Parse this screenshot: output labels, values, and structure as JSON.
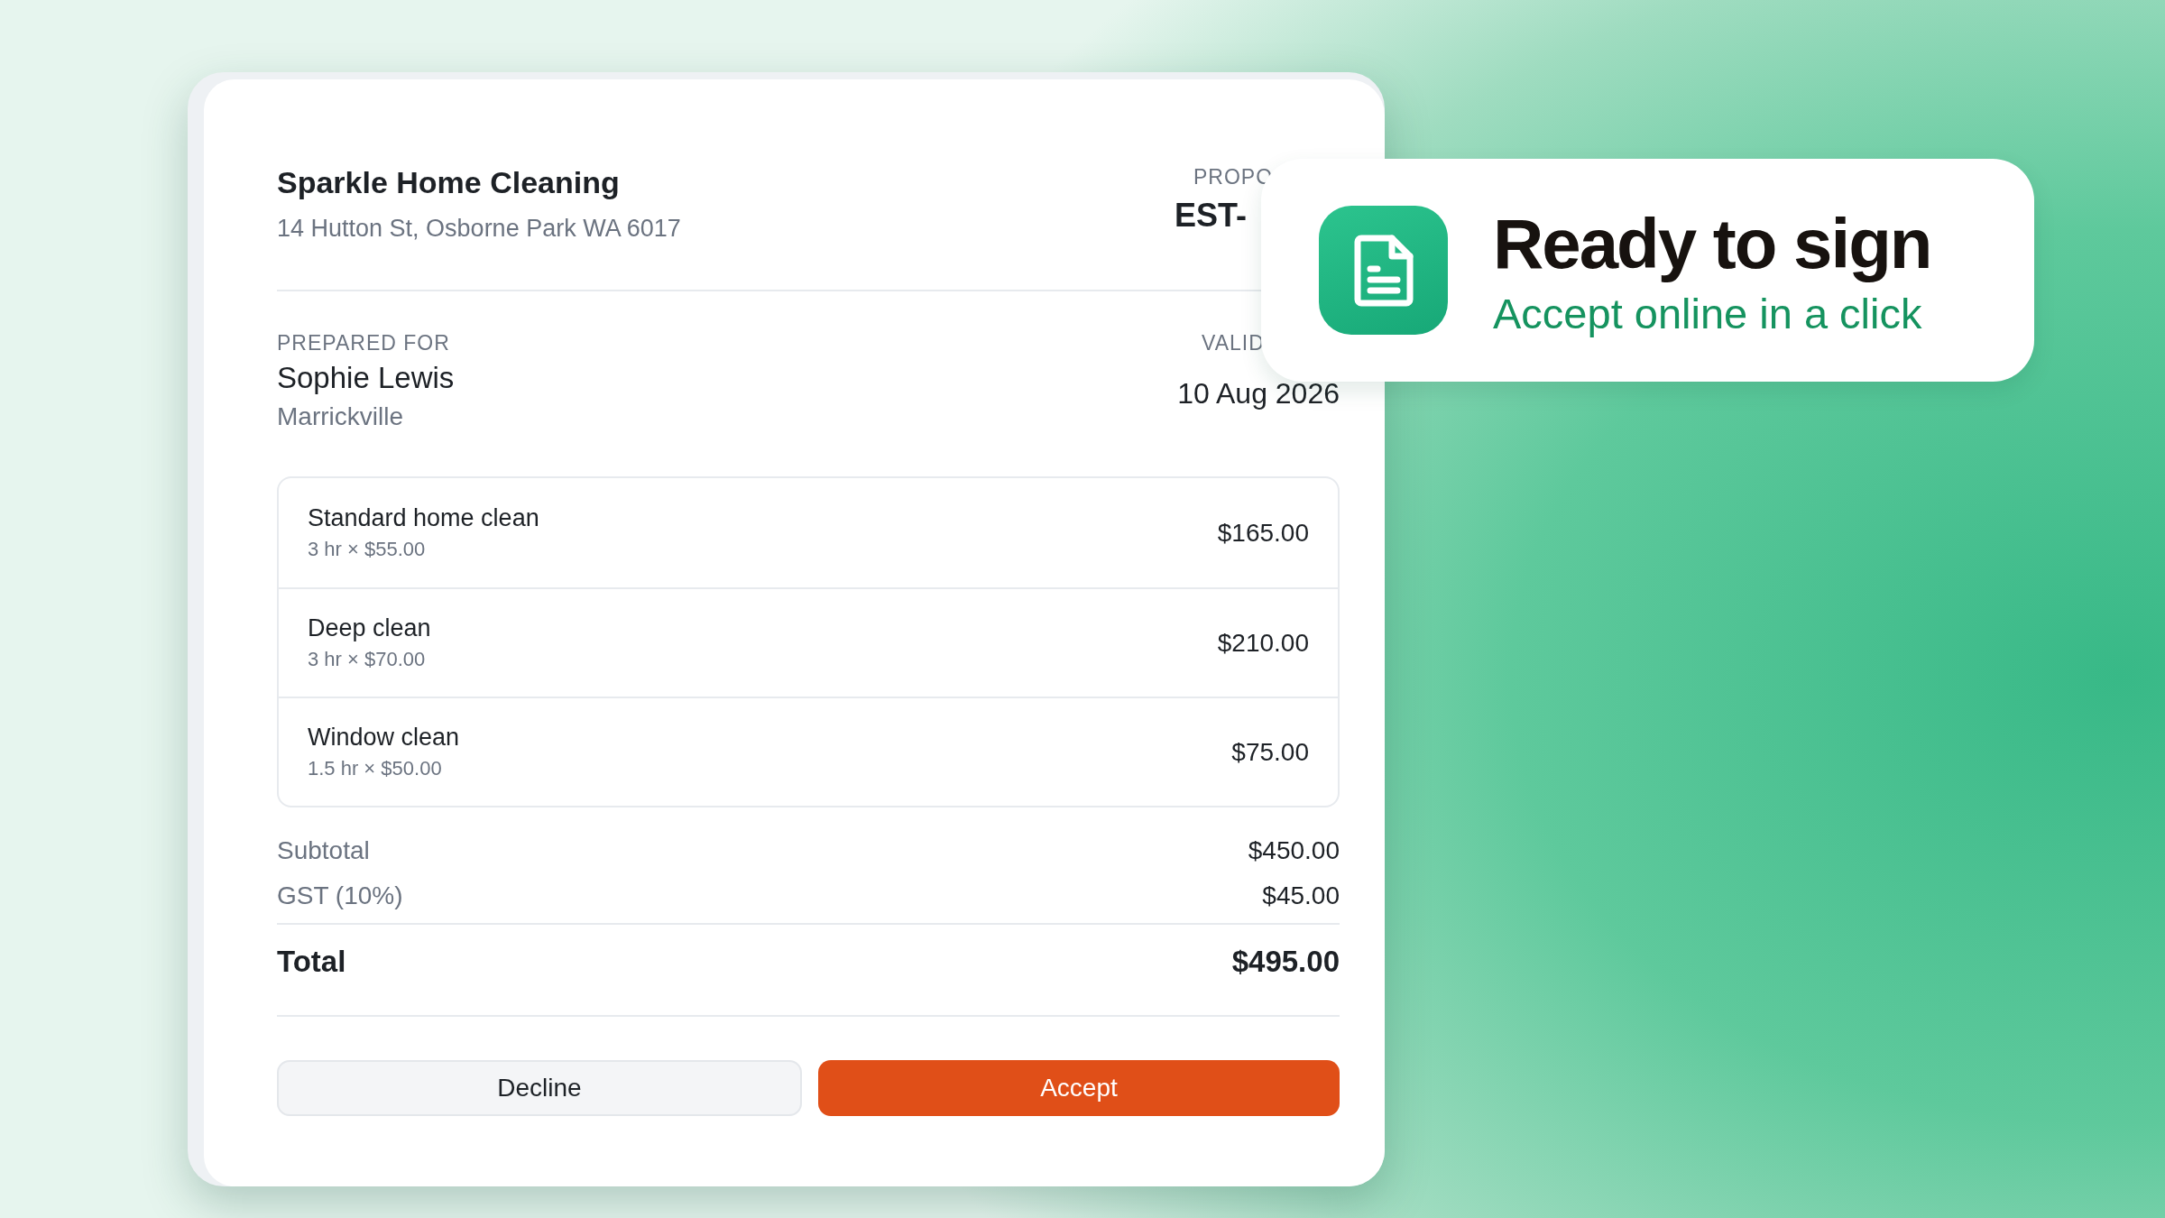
{
  "proposal": {
    "business": {
      "name": "Sparkle Home Cleaning",
      "address": "14 Hutton St, Osborne Park WA 6017"
    },
    "proposal_label": "PROPO",
    "proposal_number": "EST-",
    "prepared_for": {
      "label": "PREPARED FOR",
      "name": "Sophie Lewis",
      "suburb": "Marrickville"
    },
    "valid_label": "VALID",
    "valid_date": "10 Aug 2026",
    "items": [
      {
        "title": "Standard home clean",
        "detail": "3 hr × $55.00",
        "amount": "$165.00"
      },
      {
        "title": "Deep clean",
        "detail": "3 hr × $70.00",
        "amount": "$210.00"
      },
      {
        "title": "Window clean",
        "detail": "1.5 hr × $50.00",
        "amount": "$75.00"
      }
    ],
    "totals": [
      {
        "label": "Subtotal",
        "value": "$450.00",
        "kind": "line"
      },
      {
        "label": "GST (10%)",
        "value": "$45.00",
        "kind": "line"
      },
      {
        "label": "Total",
        "value": "$495.00",
        "kind": "grand"
      }
    ],
    "buttons": [
      {
        "label": "Decline",
        "kind": "secondary"
      },
      {
        "label": "Accept",
        "kind": "primary"
      }
    ]
  },
  "callout": {
    "title": "Ready to sign",
    "subtitle": "Accept online in a click"
  }
}
